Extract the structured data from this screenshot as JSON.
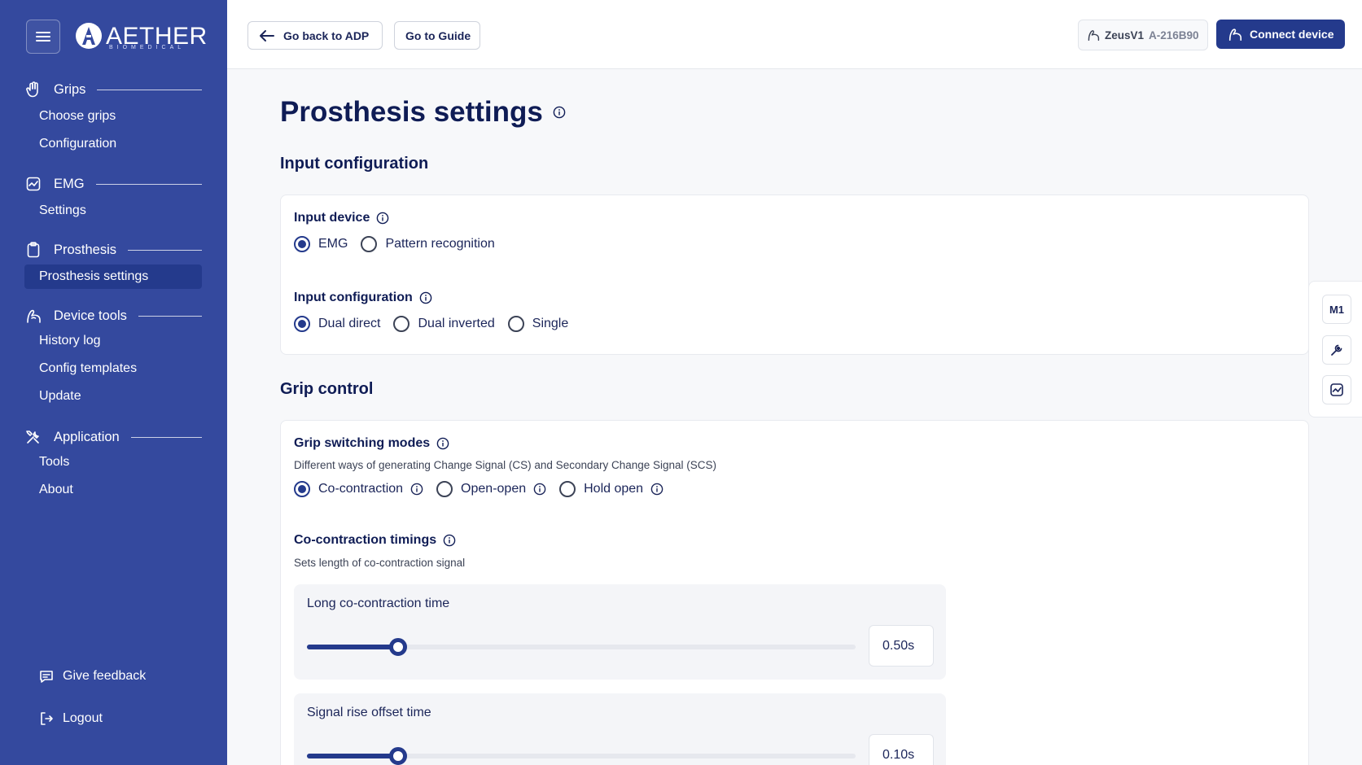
{
  "brand": {
    "name": "AETHER",
    "sub": "BIOMEDICAL"
  },
  "sidebar": {
    "sections": [
      {
        "title": "Grips",
        "icon": "hand-icon",
        "items": [
          "Choose grips",
          "Configuration"
        ]
      },
      {
        "title": "EMG",
        "icon": "chart-icon",
        "items": [
          "Settings"
        ]
      },
      {
        "title": "Prosthesis",
        "icon": "clipboard-icon",
        "items": [
          "Prosthesis settings"
        ],
        "active": "Prosthesis settings"
      },
      {
        "title": "Device tools",
        "icon": "arm-icon",
        "items": [
          "History log",
          "Config templates",
          "Update"
        ]
      },
      {
        "title": "Application",
        "icon": "tools-icon",
        "items": [
          "Tools",
          "About"
        ]
      }
    ],
    "feedback_label": "Give feedback",
    "logout_label": "Logout"
  },
  "topbar": {
    "back_label": "Go back to ADP",
    "guide_label": "Go to Guide",
    "device_name": "ZeusV1",
    "device_serial": "A-216B90",
    "connect_label": "Connect device"
  },
  "page": {
    "title": "Prosthesis settings",
    "input_section_title": "Input configuration",
    "input_device": {
      "label": "Input device",
      "options": [
        "EMG",
        "Pattern recognition"
      ],
      "selected": "EMG"
    },
    "input_configuration": {
      "label": "Input configuration",
      "options": [
        "Dual direct",
        "Dual inverted",
        "Single"
      ],
      "selected": "Dual direct"
    },
    "grip_section_title": "Grip control",
    "grip_switching": {
      "label": "Grip switching modes",
      "description": "Different ways of generating Change Signal (CS) and Secondary Change Signal (SCS)",
      "options": [
        "Co-contraction",
        "Open-open",
        "Hold open"
      ],
      "selected": "Co-contraction"
    },
    "cocontraction_timings": {
      "label": "Co-contraction timings",
      "description": "Sets length of co-contraction signal",
      "sliders": [
        {
          "label": "Long co-contraction time",
          "value": "0.50s",
          "fraction": 0.166
        },
        {
          "label": "Signal rise offset time",
          "value": "0.10s",
          "fraction": 0.166
        }
      ]
    }
  },
  "dock": {
    "m1_label": "M1"
  },
  "colors": {
    "sidebar": "#34499e",
    "accent": "#243a8c",
    "title": "#0f1c55"
  }
}
